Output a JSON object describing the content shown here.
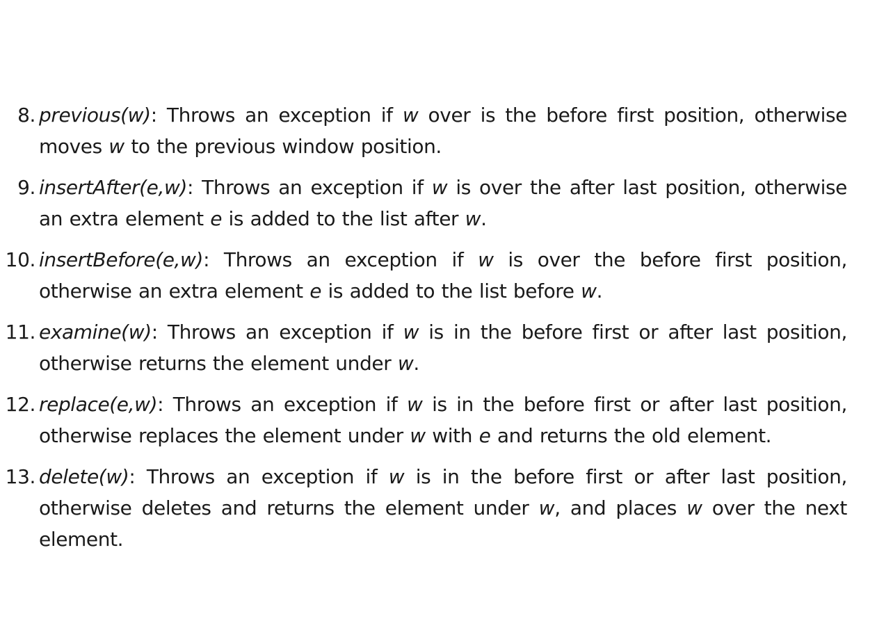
{
  "operations": [
    {
      "number": "8.",
      "name": "previous(w)",
      "parts": [
        {
          "t": ": Throws an exception if ",
          "i": false
        },
        {
          "t": "w",
          "i": true
        },
        {
          "t": " over is the before first position, otherwise moves ",
          "i": false
        },
        {
          "t": "w",
          "i": true
        },
        {
          "t": " to the previous window position.",
          "i": false
        }
      ]
    },
    {
      "number": "9.",
      "name": "insertAfter(e,w)",
      "parts": [
        {
          "t": ": Throws an exception if ",
          "i": false
        },
        {
          "t": "w",
          "i": true
        },
        {
          "t": " is over the after last position, other­wise an extra element ",
          "i": false
        },
        {
          "t": "e",
          "i": true
        },
        {
          "t": " is added to the list after ",
          "i": false
        },
        {
          "t": "w",
          "i": true
        },
        {
          "t": ".",
          "i": false
        }
      ]
    },
    {
      "number": "10.",
      "name": "insertBefore(e,w)",
      "parts": [
        {
          "t": ": Throws an exception if ",
          "i": false
        },
        {
          "t": "w",
          "i": true
        },
        {
          "t": " is over the before first position, otherwise an extra element ",
          "i": false
        },
        {
          "t": "e",
          "i": true
        },
        {
          "t": " is added to the list before ",
          "i": false
        },
        {
          "t": "w",
          "i": true
        },
        {
          "t": ".",
          "i": false
        }
      ]
    },
    {
      "number": "11.",
      "name": "examine(w)",
      "parts": [
        {
          "t": ": Throws an exception if ",
          "i": false
        },
        {
          "t": "w",
          "i": true
        },
        {
          "t": " is in the before first or after last position, otherwise returns the element under ",
          "i": false
        },
        {
          "t": "w",
          "i": true
        },
        {
          "t": ".",
          "i": false
        }
      ]
    },
    {
      "number": "12.",
      "name": "replace(e,w)",
      "parts": [
        {
          "t": ": Throws an exception if ",
          "i": false
        },
        {
          "t": "w",
          "i": true
        },
        {
          "t": " is in the before first or after last position, otherwise replaces the element under ",
          "i": false
        },
        {
          "t": "w",
          "i": true
        },
        {
          "t": " with ",
          "i": false
        },
        {
          "t": "e",
          "i": true
        },
        {
          "t": " and returns the old element.",
          "i": false
        }
      ]
    },
    {
      "number": "13.",
      "name": "delete(w)",
      "parts": [
        {
          "t": ": Throws an exception if ",
          "i": false
        },
        {
          "t": "w",
          "i": true
        },
        {
          "t": " is in the before first or after last position, otherwise deletes and returns the element under ",
          "i": false
        },
        {
          "t": "w",
          "i": true
        },
        {
          "t": ", and places ",
          "i": false
        },
        {
          "t": "w",
          "i": true
        },
        {
          "t": " over the next element.",
          "i": false
        }
      ]
    }
  ]
}
